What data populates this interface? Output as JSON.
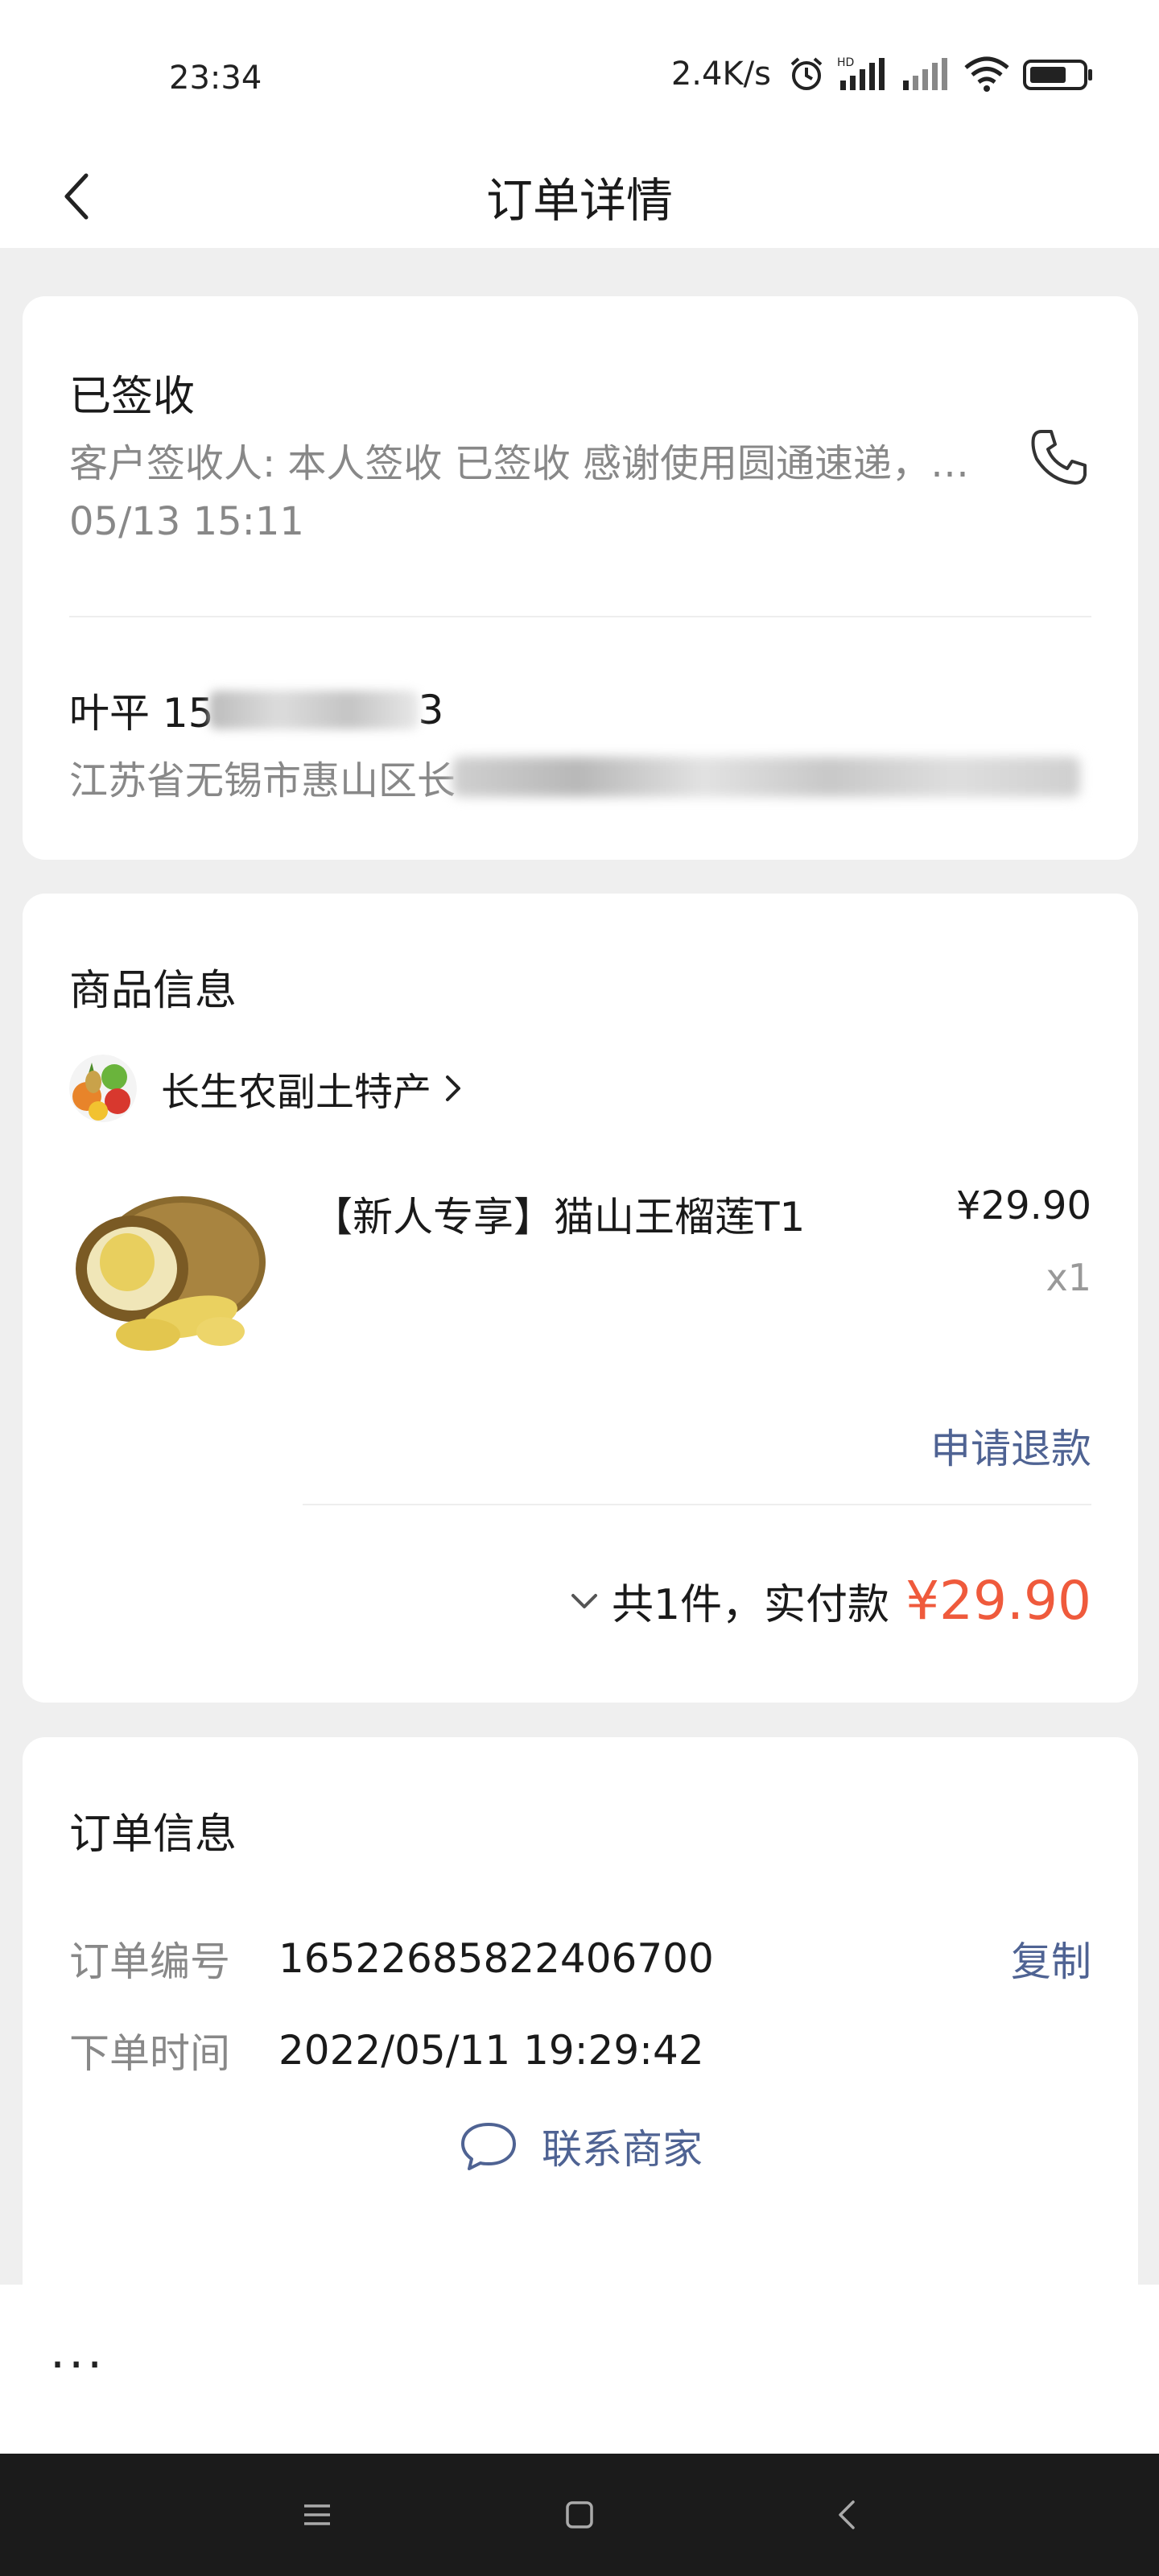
{
  "status_bar": {
    "time": "23:34",
    "speed": "2.4K/s"
  },
  "header": {
    "title": "订单详情"
  },
  "delivery": {
    "status": "已签收",
    "detail": "客户签收人: 本人签收 已签收 感谢使用圆通速递，期待再次为您服务 投诉电话：",
    "time": "05/13 15:11",
    "receiver_name": "叶平 15",
    "receiver_phone_tail": "3",
    "address_prefix": "江苏省无锡市惠山区长"
  },
  "goods": {
    "section_title": "商品信息",
    "shop_name": "长生农副土特产",
    "product_name": "【新人专享】猫山王榴莲T1",
    "price": "¥29.90",
    "quantity": "x1",
    "refund_label": "申请退款",
    "total_text": "共1件，实付款",
    "total_amount": "¥29.90"
  },
  "order_info": {
    "section_title": "订单信息",
    "number_label": "订单编号",
    "number_value": "16522685822406700",
    "copy_label": "复制",
    "time_label": "下单时间",
    "time_value": "2022/05/11 19:29:42",
    "contact_label": "联系商家"
  },
  "bottom_bar": {
    "more_label": "···"
  },
  "colors": {
    "accent_blue": "#4f6393",
    "price_red": "#ef5a3c",
    "page_bg": "#efefef"
  }
}
